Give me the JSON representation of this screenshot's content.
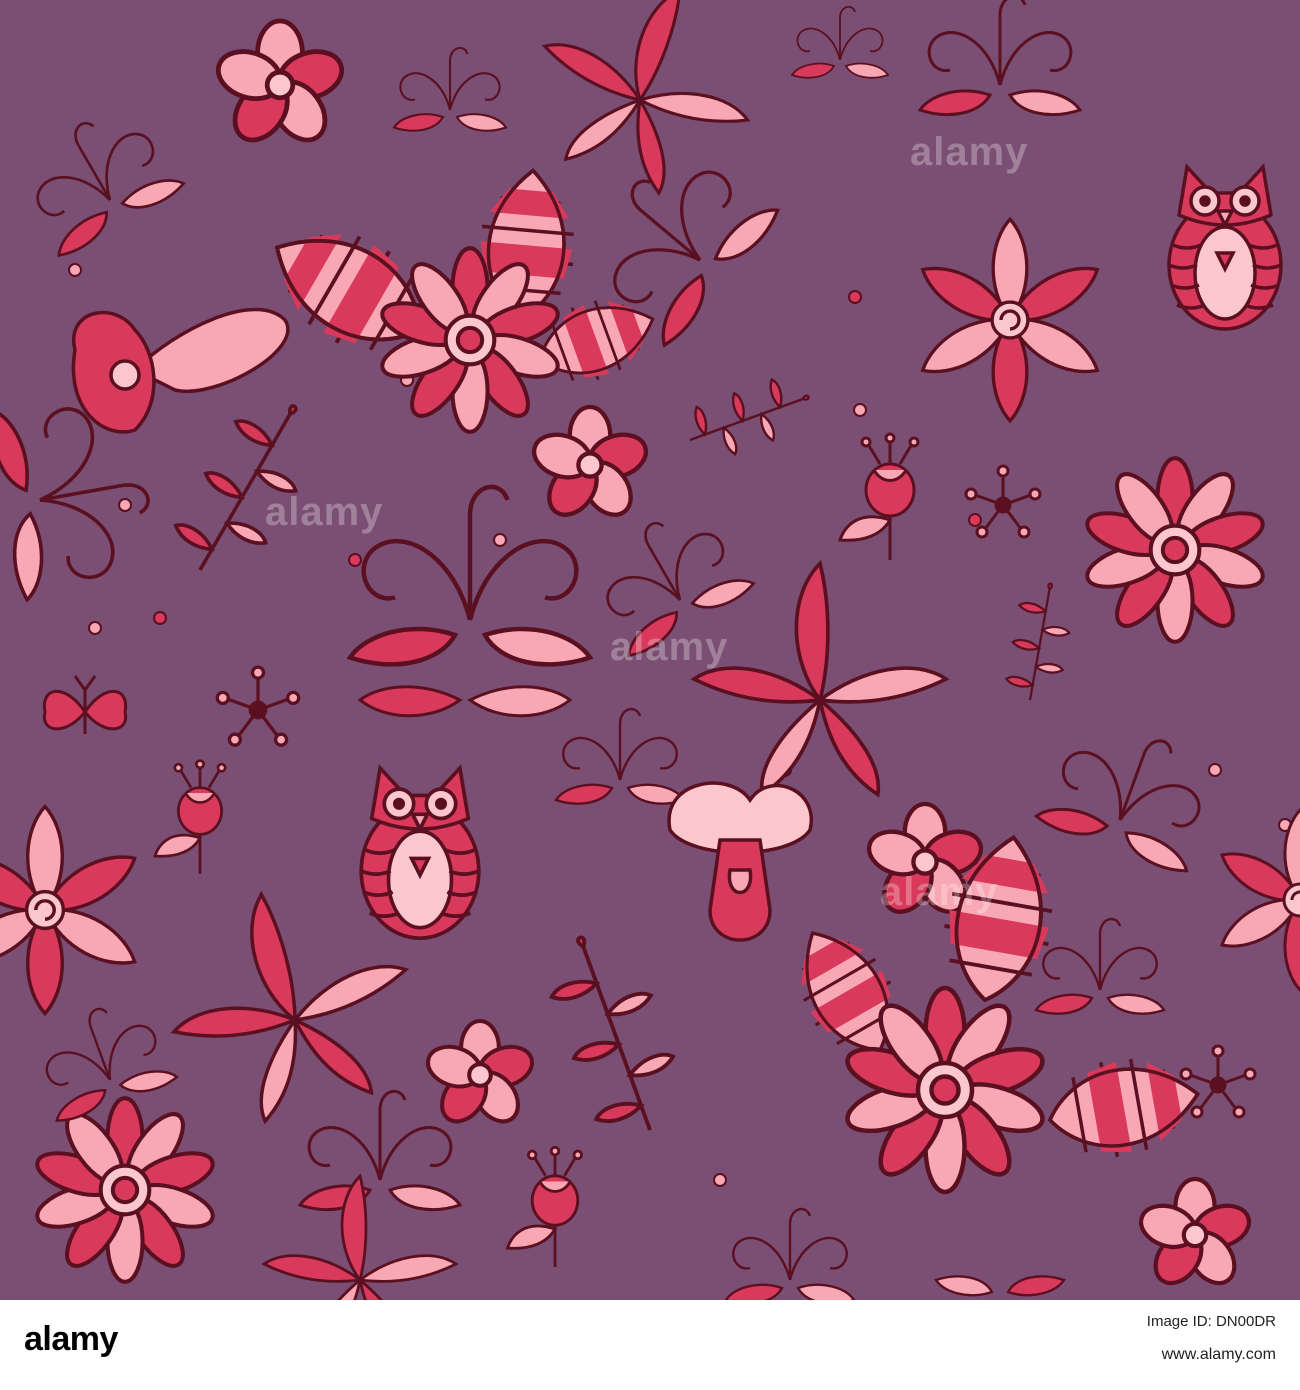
{
  "image": {
    "background_color": "#7b4f74",
    "outline_color": "#5a1020",
    "petal_red": "#d93a5c",
    "petal_pink": "#f7a8b4",
    "petal_pale": "#fbc6cc"
  },
  "watermark": {
    "text": "alamy"
  },
  "footer": {
    "logo_text": "alamy",
    "image_id": "Image ID: DN00DR",
    "url": "www.alamy.com"
  }
}
